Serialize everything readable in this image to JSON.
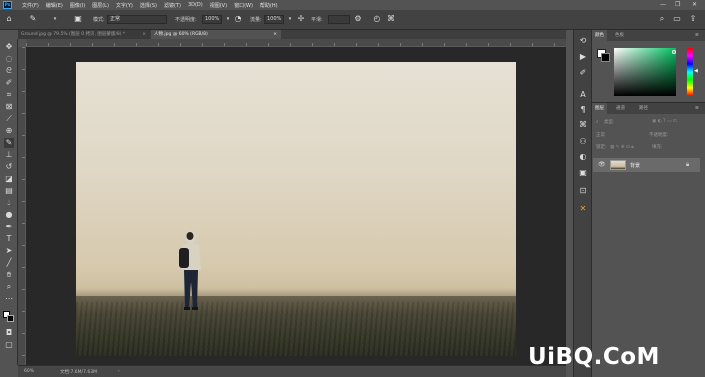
{
  "menubar": {
    "logo": "Ps",
    "items": [
      "文件(F)",
      "编辑(E)",
      "图像(I)",
      "图层(L)",
      "文字(Y)",
      "选择(S)",
      "滤镜(T)",
      "3D(D)",
      "视图(V)",
      "窗口(W)",
      "帮助(H)"
    ]
  },
  "options": {
    "mode_label": "模式:",
    "mode_value": "正常",
    "opacity_label": "不透明度:",
    "opacity_value": "100%",
    "flow_label": "流量:",
    "flow_value": "100%",
    "smooth_label": "平滑:"
  },
  "tabs": [
    {
      "label": "Ground.jpg @ 79.5% (图层 0 拷贝, 图层蒙版/8) *"
    },
    {
      "label": "人物.jpg @ 60% (RGB/8)"
    }
  ],
  "status": {
    "zoom": "60%",
    "doc": "文档:7.6M/7.63M"
  },
  "color_panel": {
    "tabs": [
      "颜色",
      "色板"
    ]
  },
  "layers_panel": {
    "tabs": [
      "图层",
      "通道",
      "路径"
    ],
    "kind_label": "类型",
    "blend_mode": "正常",
    "opacity_label": "不透明度:",
    "lock_label": "锁定:",
    "fill_label": "填充:",
    "layers": [
      {
        "name": "背景"
      }
    ]
  },
  "watermark": "UiBQ.CoM"
}
